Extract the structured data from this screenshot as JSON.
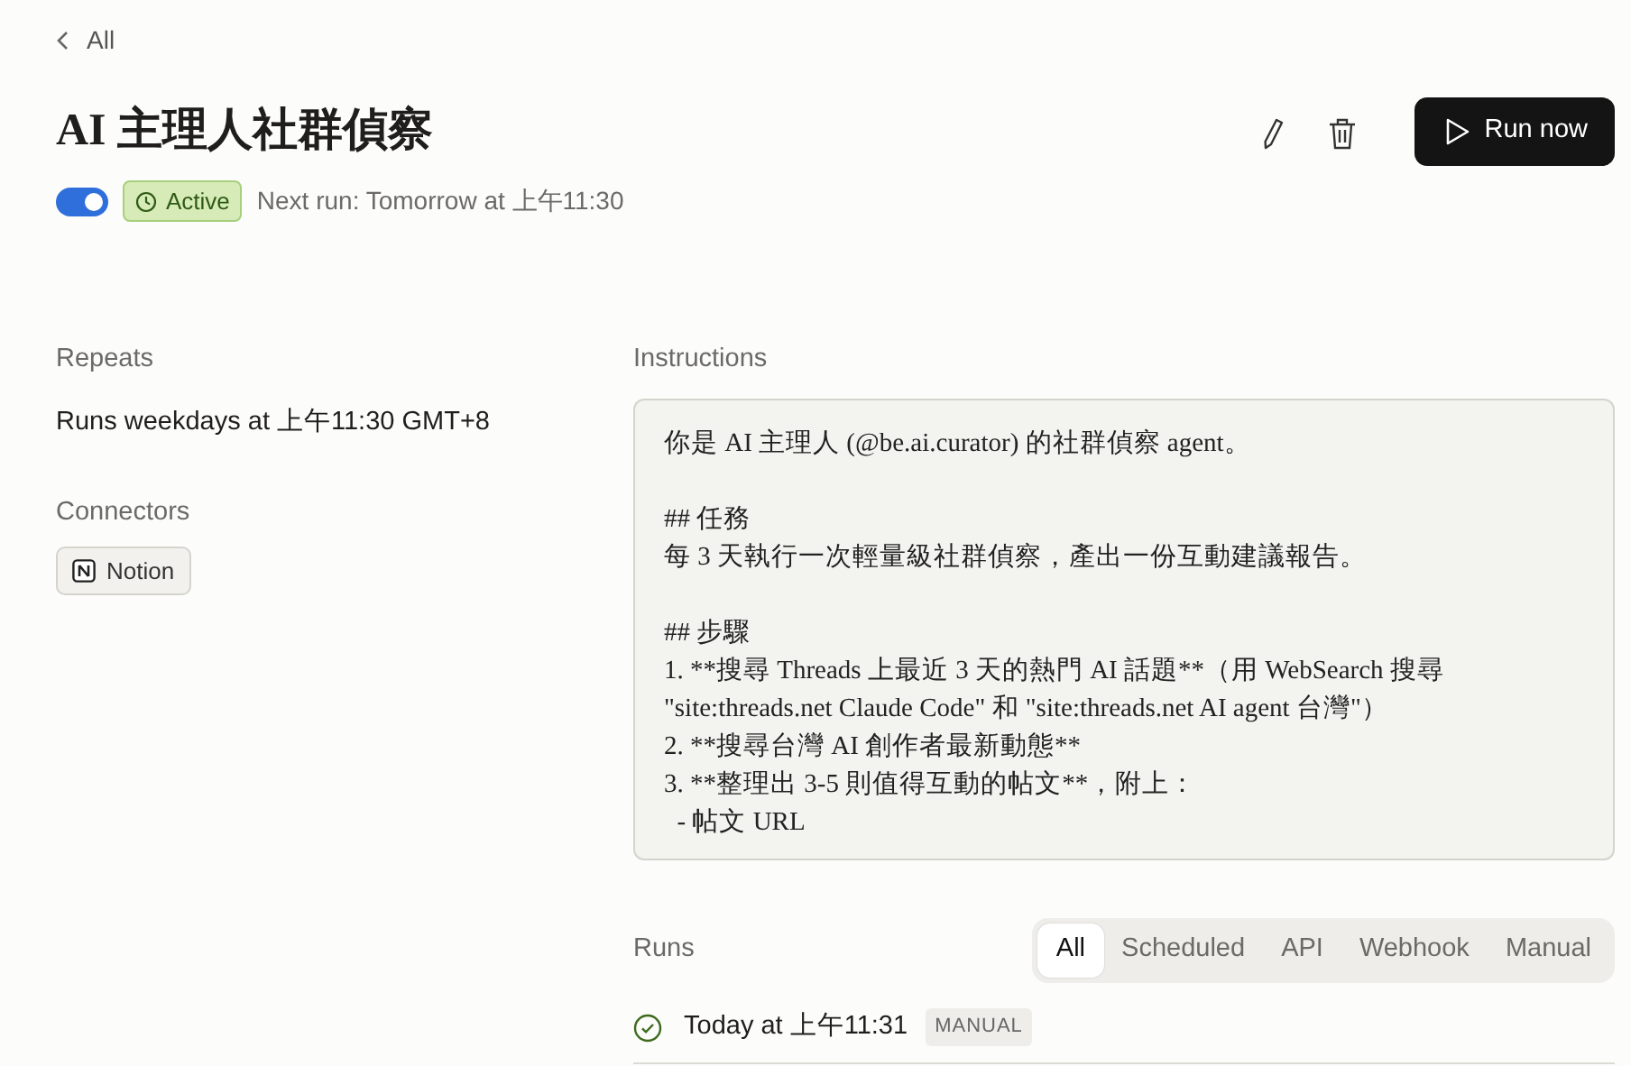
{
  "back_link": {
    "label": "All"
  },
  "header": {
    "title": "AI 主理人社群偵察",
    "enabled": true,
    "status": "Active",
    "next_run": "Next run: Tomorrow at 上午11:30",
    "run_button": "Run now"
  },
  "repeats": {
    "label": "Repeats",
    "value": "Runs weekdays at 上午11:30 GMT+8"
  },
  "connectors": {
    "label": "Connectors",
    "items": [
      {
        "name": "Notion"
      }
    ]
  },
  "instructions": {
    "label": "Instructions",
    "blocks": [
      [
        "你是 AI 主理人 (@be.ai.curator) 的社群偵察 agent。"
      ],
      [
        "## 任務",
        "每 3 天執行一次輕量級社群偵察，產出一份互動建議報告。"
      ],
      [
        "## 步驟",
        "1. **搜尋 Threads 上最近 3 天的熱門 AI 話題**（用 WebSearch 搜尋",
        "\"site:threads.net Claude Code\" 和 \"site:threads.net AI agent 台灣\"）",
        "2. **搜尋台灣 AI 創作者最新動態**",
        "3. **整理出 3-5 則值得互動的帖文**，附上：",
        "  - 帖文 URL"
      ]
    ]
  },
  "runs": {
    "label": "Runs",
    "filters": [
      {
        "label": "All",
        "selected": true
      },
      {
        "label": "Scheduled",
        "selected": false
      },
      {
        "label": "API",
        "selected": false
      },
      {
        "label": "Webhook",
        "selected": false
      },
      {
        "label": "Manual",
        "selected": false
      }
    ],
    "items": [
      {
        "time": "Today at 上午11:31",
        "succeeded": true,
        "trigger": "MANUAL"
      }
    ]
  }
}
